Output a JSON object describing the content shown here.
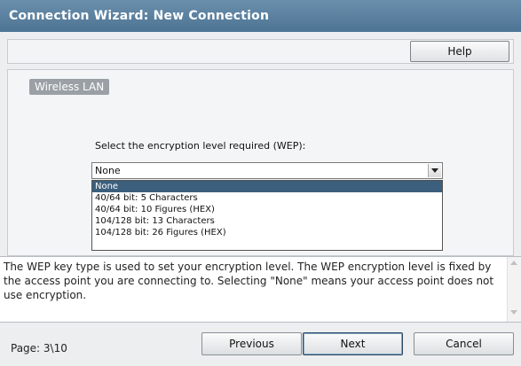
{
  "window": {
    "title": "Connection Wizard: New Connection"
  },
  "toolbar": {
    "help_label": "Help"
  },
  "section": {
    "label": "Wireless LAN"
  },
  "encryption": {
    "prompt": "Select the encryption level required (WEP):",
    "selected": "None",
    "options": [
      "None",
      "40/64 bit: 5 Characters",
      "40/64 bit: 10 Figures (HEX)",
      "104/128 bit: 13 Characters",
      "104/128 bit: 26 Figures (HEX)"
    ]
  },
  "description": {
    "text": "The WEP key type is used to set your encryption level.  The WEP encryption level is fixed by the access point you are connecting to.  Selecting \"None\" means your access point does not use encryption."
  },
  "footer": {
    "page_label": "Page:  3\\10",
    "previous_label": "Previous",
    "next_label": "Next",
    "cancel_label": "Cancel"
  }
}
